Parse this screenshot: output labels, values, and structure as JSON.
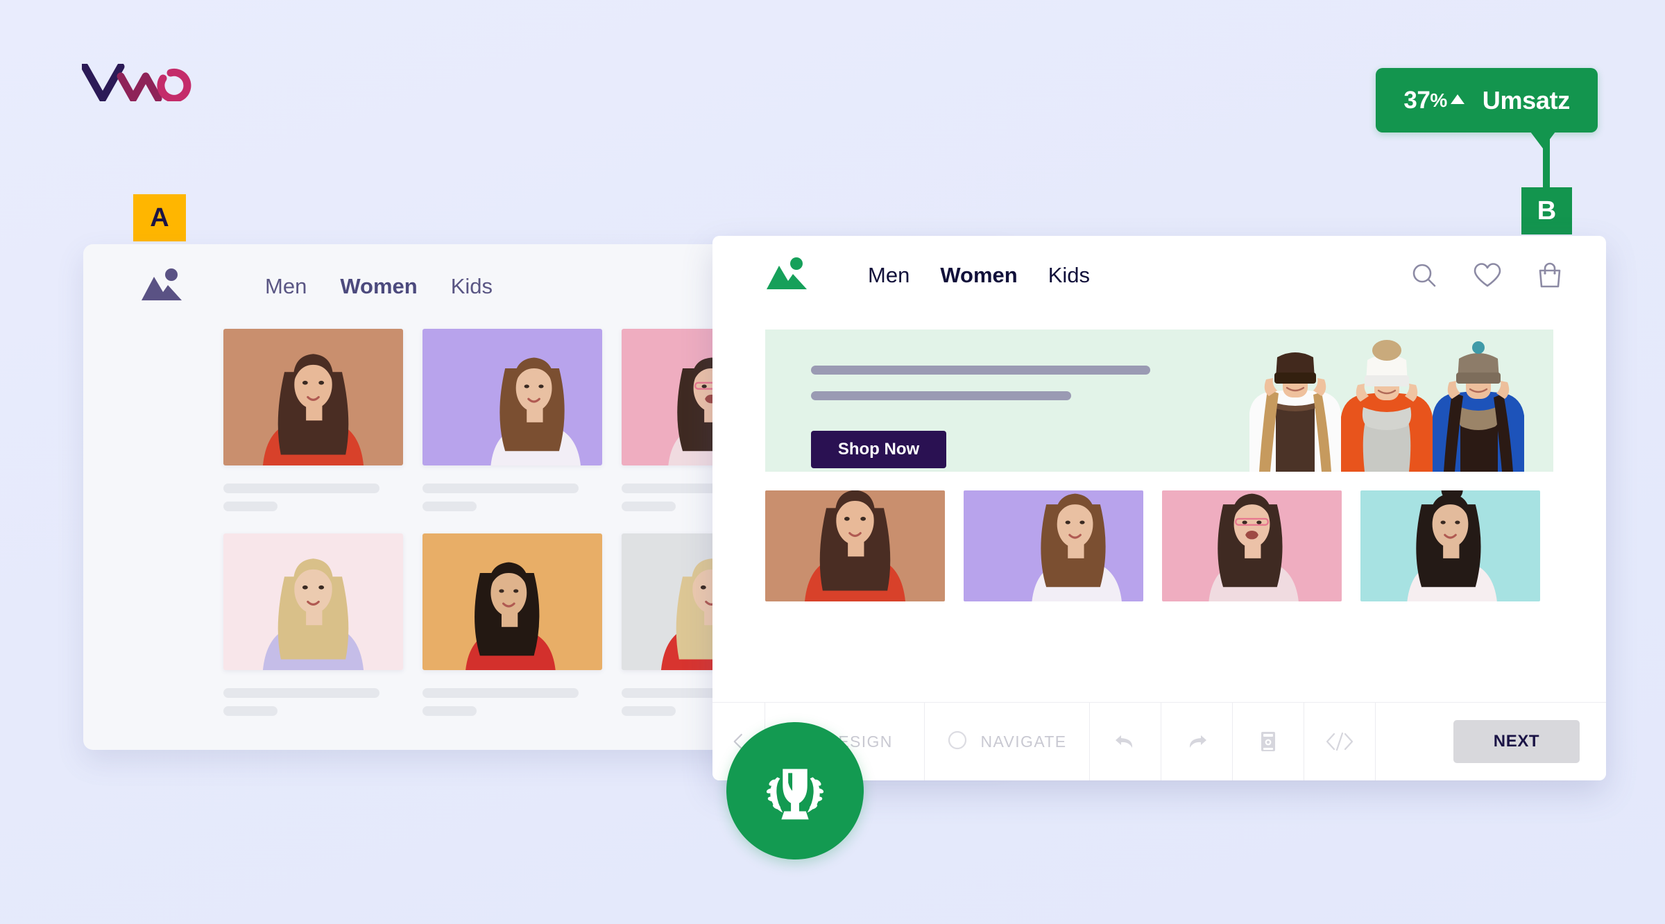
{
  "brand": {
    "logo_name": "vwo-logo",
    "logo_colors": [
      "#2b1a56",
      "#c42c6a"
    ]
  },
  "background_color": "#e6eafb",
  "uplift_badge": {
    "value": "37",
    "percent_symbol": "%",
    "direction_icon": "triangle-up-icon",
    "label": "Umsatz",
    "color": "#13954e"
  },
  "variant_a": {
    "badge_label": "A",
    "badge_color": "#ffb600",
    "badge_text_color": "#1b1446",
    "nav": {
      "logo_name": "mountain-logo-icon",
      "logo_color": "#5a5284",
      "links": [
        {
          "label": "Men",
          "active": false
        },
        {
          "label": "Women",
          "active": true
        },
        {
          "label": "Kids",
          "active": false
        }
      ]
    },
    "products_row_1": [
      {
        "name": "product-card-1",
        "bg": "#c98f6e",
        "skin": "#e8b998",
        "hair": "#4a2d23",
        "dress": "#d8412a",
        "pose": "front"
      },
      {
        "name": "product-card-2",
        "bg": "#b8a3ec",
        "skin": "#e9c0a2",
        "hair": "#7b4f31",
        "dress": "#f2eef6",
        "pose": "side"
      },
      {
        "name": "product-card-3",
        "bg": "#efadc0",
        "skin": "#ecc2a8",
        "hair": "#3f2a22",
        "dress": "#f0dbe0",
        "pose": "laugh"
      }
    ],
    "products_row_2": [
      {
        "name": "product-card-4",
        "bg": "#f8e6ea",
        "skin": "#eccbb0",
        "hair": "#d9c089",
        "dress": "#c5bde8",
        "pose": "front"
      },
      {
        "name": "product-card-5",
        "bg": "#e8ae67",
        "skin": "#dfb38c",
        "hair": "#231812",
        "dress": "#d3302c",
        "pose": "hair"
      },
      {
        "name": "product-card-6",
        "bg": "#dfe1e3",
        "skin": "#ecc9ae",
        "hair": "#ddc795",
        "dress": "#d8342f",
        "pose": "front"
      }
    ]
  },
  "variant_b": {
    "badge_label": "B",
    "badge_color": "#13954e",
    "badge_text_color": "#ffffff",
    "nav": {
      "logo_name": "mountain-logo-icon",
      "logo_color": "#16a05a",
      "links": [
        {
          "label": "Men",
          "active": false
        },
        {
          "label": "Women",
          "active": true
        },
        {
          "label": "Kids",
          "active": false
        }
      ],
      "icons": [
        "search-icon",
        "heart-icon",
        "shopping-bag-icon"
      ]
    },
    "hero": {
      "background": "#e2f3e8",
      "headline_placeholder_1": "",
      "headline_placeholder_2": "",
      "cta_label": "Shop Now",
      "cta_color": "#2a1152",
      "image_name": "three-women-in-knit-hats"
    },
    "products": [
      {
        "name": "product-card-1",
        "bg": "#c98f6e",
        "skin": "#e8b998",
        "hair": "#4a2d23",
        "dress": "#d8412a",
        "pose": "front"
      },
      {
        "name": "product-card-2",
        "bg": "#b8a3ec",
        "skin": "#e9c0a2",
        "hair": "#7b4f31",
        "dress": "#f2eef6",
        "pose": "side"
      },
      {
        "name": "product-card-3",
        "bg": "#efadc0",
        "skin": "#ecc2a8",
        "hair": "#3f2a22",
        "dress": "#f0dbe0",
        "pose": "laugh"
      },
      {
        "name": "product-card-4",
        "bg": "#a7e2e2",
        "skin": "#e3bb9c",
        "hair": "#241a16",
        "dress": "#f6eef0",
        "pose": "bun"
      }
    ]
  },
  "editor_toolbar": {
    "back_icon": "chevron-left-icon",
    "design_label": "DESIGN",
    "design_icon": "design-square-icon",
    "navigate_label": "NAVIGATE",
    "navigate_icon": "circle-icon",
    "undo_icon": "undo-arrow-icon",
    "redo_icon": "redo-arrow-icon",
    "device_icon": "device-preview-icon",
    "code_icon": "code-brackets-icon",
    "next_label": "NEXT",
    "winner_icon": "trophy-laurel-icon",
    "winner_color": "#139a51"
  }
}
